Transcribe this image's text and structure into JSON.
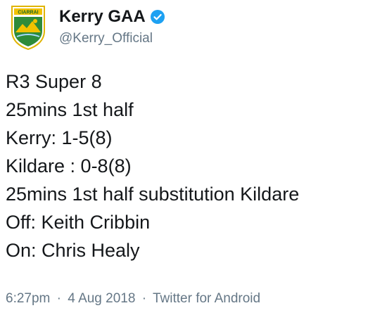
{
  "author": {
    "display_name": "Kerry GAA",
    "handle": "@Kerry_Official",
    "avatar_text": "CIARRAI",
    "verified_icon": "verified-check-icon",
    "colors": {
      "verified": "#1da1f2",
      "crest_green": "#2e8b3a",
      "crest_gold": "#f2c200"
    }
  },
  "tweet": {
    "lines": [
      "R3 Super 8",
      "25mins 1st half",
      "Kerry: 1-5(8)",
      "Kildare : 0-8(8)",
      "25mins 1st half substitution Kildare",
      "Off: Keith Cribbin",
      "On: Chris Healy"
    ]
  },
  "meta": {
    "time": "6:27pm",
    "date": "4 Aug 2018",
    "source": "Twitter for Android",
    "separator": "·"
  }
}
